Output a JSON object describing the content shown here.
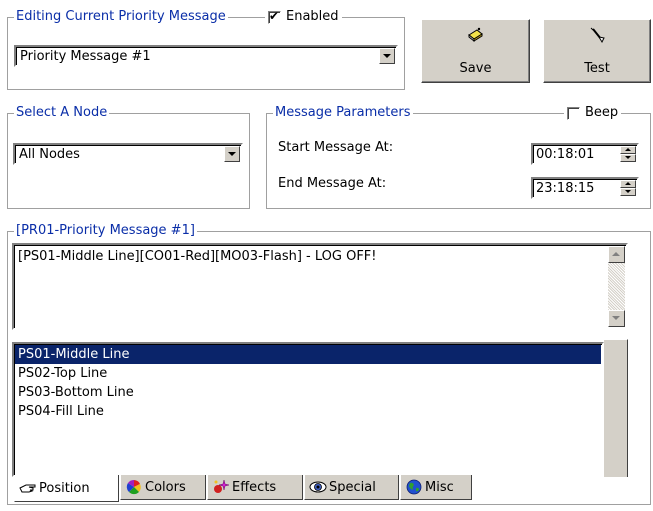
{
  "editing_group": {
    "legend": "Editing Current Priority Message",
    "enabled_label": "Enabled",
    "enabled_checked": true,
    "message_select": "Priority Message #1"
  },
  "buttons": {
    "save_label": "Save",
    "save_icon": "save-eraser-icon",
    "test_label": "Test",
    "test_icon": "test-wand-icon"
  },
  "node_group": {
    "legend": "Select A Node",
    "node_select": "All Nodes"
  },
  "params_group": {
    "legend": "Message Parameters",
    "beep_label": "Beep",
    "beep_checked": false,
    "start_label": "Start Message At:",
    "start_value": "00:18:01",
    "end_label": "End Message At:",
    "end_value": "23:18:15"
  },
  "message_group": {
    "legend": "[PR01-Priority Message #1]",
    "text": "[PS01-Middle Line][CO01-Red][MO03-Flash] - LOG OFF!"
  },
  "list": {
    "items": [
      "PS01-Middle Line",
      "PS02-Top Line",
      "PS03-Bottom Line",
      "PS04-Fill Line"
    ],
    "selected_index": 0
  },
  "tabs": [
    {
      "label": "Position",
      "icon": "position-hand-icon",
      "active": true
    },
    {
      "label": "Colors",
      "icon": "colors-wheel-icon",
      "active": false
    },
    {
      "label": "Effects",
      "icon": "effects-sparkle-icon",
      "active": false
    },
    {
      "label": "Special",
      "icon": "special-eye-icon",
      "active": false
    },
    {
      "label": "Misc",
      "icon": "misc-globe-icon",
      "active": false
    }
  ],
  "colors": {
    "legend_text": "#0a2ea8",
    "selection": "#0a246a",
    "face": "#d4d0c8"
  }
}
